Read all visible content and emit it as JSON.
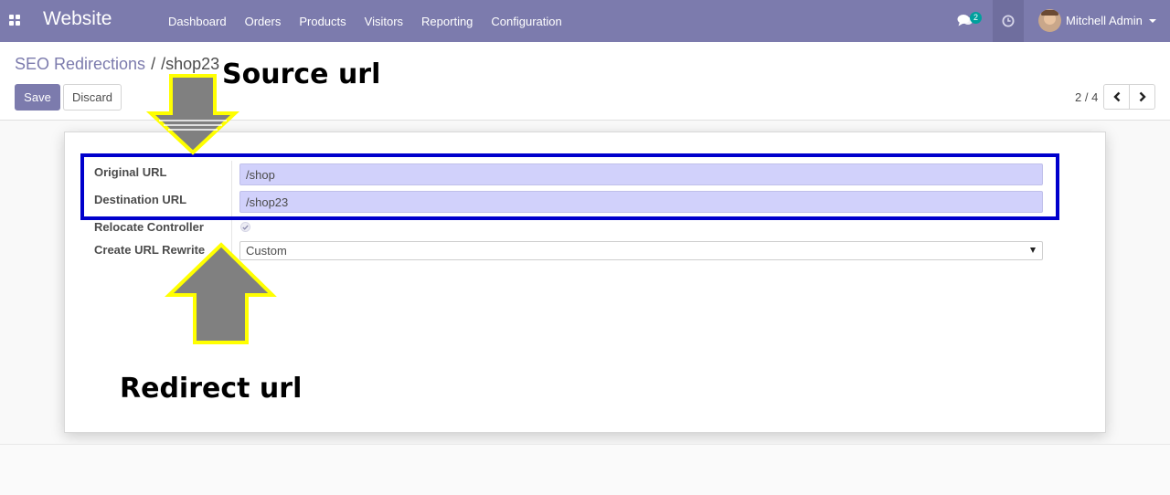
{
  "navbar": {
    "brand": "Website",
    "menu": [
      "Dashboard",
      "Orders",
      "Products",
      "Visitors",
      "Reporting",
      "Configuration"
    ],
    "chat_count": "2",
    "user_name": "Mitchell Admin",
    "bg_color": "#7c7bad"
  },
  "breadcrumb": {
    "parent": "SEO Redirections",
    "separator": "/",
    "current": "/shop23"
  },
  "buttons": {
    "save": "Save",
    "discard": "Discard"
  },
  "pager": {
    "value": "2 / 4"
  },
  "form": {
    "original_url_label": "Original URL",
    "original_url_value": "/shop",
    "destination_url_label": "Destination URL",
    "destination_url_value": "/shop23",
    "relocate_controller_label": "Relocate Controller",
    "relocate_controller_checked": true,
    "create_url_rewrite_label": "Create URL Rewrite",
    "create_url_rewrite_value": "Custom"
  },
  "annotations": {
    "source_label": "Source url",
    "redirect_label": "Redirect url",
    "highlight_color": "#0000cc",
    "arrow_outline_color": "#ffff00",
    "arrow_fill_color": "#808080"
  },
  "icons": {
    "apps": "apps-grid-icon",
    "chat": "chat-icon",
    "activity": "clock-icon",
    "prev": "chevron-left-icon",
    "next": "chevron-right-icon",
    "dropdown": "caret-down-icon",
    "check": "check-icon"
  }
}
